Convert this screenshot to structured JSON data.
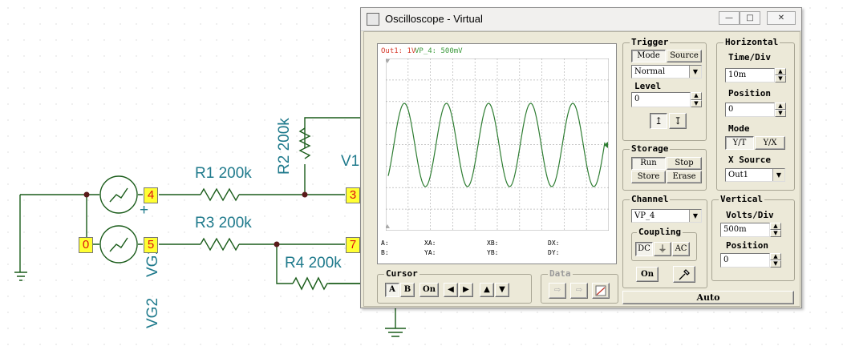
{
  "schematic": {
    "nodes": [
      "4",
      "5",
      "0",
      "3",
      "7"
    ],
    "labels": {
      "r1": "R1 200k",
      "r2": "R2 200k",
      "r3": "R3 200k",
      "r4": "R4 200k",
      "v1": "V1",
      "vg1": "VG1",
      "vg2": "VG2",
      "plus": "+"
    }
  },
  "window": {
    "title": "Oscilloscope - Virtual",
    "minimize_icon": "minimize-icon",
    "maximize_icon": "maximize-icon",
    "close_icon": "close-icon"
  },
  "screen": {
    "channel_a_label": "Out1: 1V",
    "channel_b_label": "VP_4: 500mV",
    "channel_a_color": "#d63a2a",
    "channel_b_color": "#3c9a3c",
    "trace_color": "#2e7d32",
    "readouts": {
      "a": "A:",
      "b": "B:",
      "xa": "XA:",
      "ya": "YA:",
      "xb": "XB:",
      "yb": "YB:",
      "dx": "DX:",
      "dy": "DY:"
    }
  },
  "trigger": {
    "title": "Trigger",
    "mode_label": "Mode",
    "source_label": "Source",
    "mode_value": "Normal",
    "level_label": "Level",
    "level_value": "0",
    "rising_icon": "rising-edge-icon",
    "falling_icon": "falling-edge-icon"
  },
  "horizontal": {
    "title": "Horizontal",
    "time_div_label": "Time/Div",
    "time_div_value": "10m",
    "position_label": "Position",
    "position_value": "0",
    "mode_label": "Mode",
    "mode_yt": "Y/T",
    "mode_yx": "Y/X",
    "x_source_label": "X Source",
    "x_source_value": "Out1"
  },
  "storage": {
    "title": "Storage",
    "run": "Run",
    "stop": "Stop",
    "store": "Store",
    "erase": "Erase"
  },
  "channel": {
    "title": "Channel",
    "value": "VP_4",
    "coupling_title": "Coupling",
    "dc": "DC",
    "gnd_icon": "ground-icon",
    "ac": "AC",
    "on": "On",
    "probe_icon": "probe-icon"
  },
  "vertical": {
    "title": "Vertical",
    "volts_div_label": "Volts/Div",
    "volts_div_value": "500m",
    "position_label": "Position",
    "position_value": "0"
  },
  "cursor": {
    "title": "Cursor",
    "a": "A",
    "b": "B",
    "on": "On"
  },
  "data_group": {
    "title": "Data"
  },
  "auto_label": "Auto"
}
